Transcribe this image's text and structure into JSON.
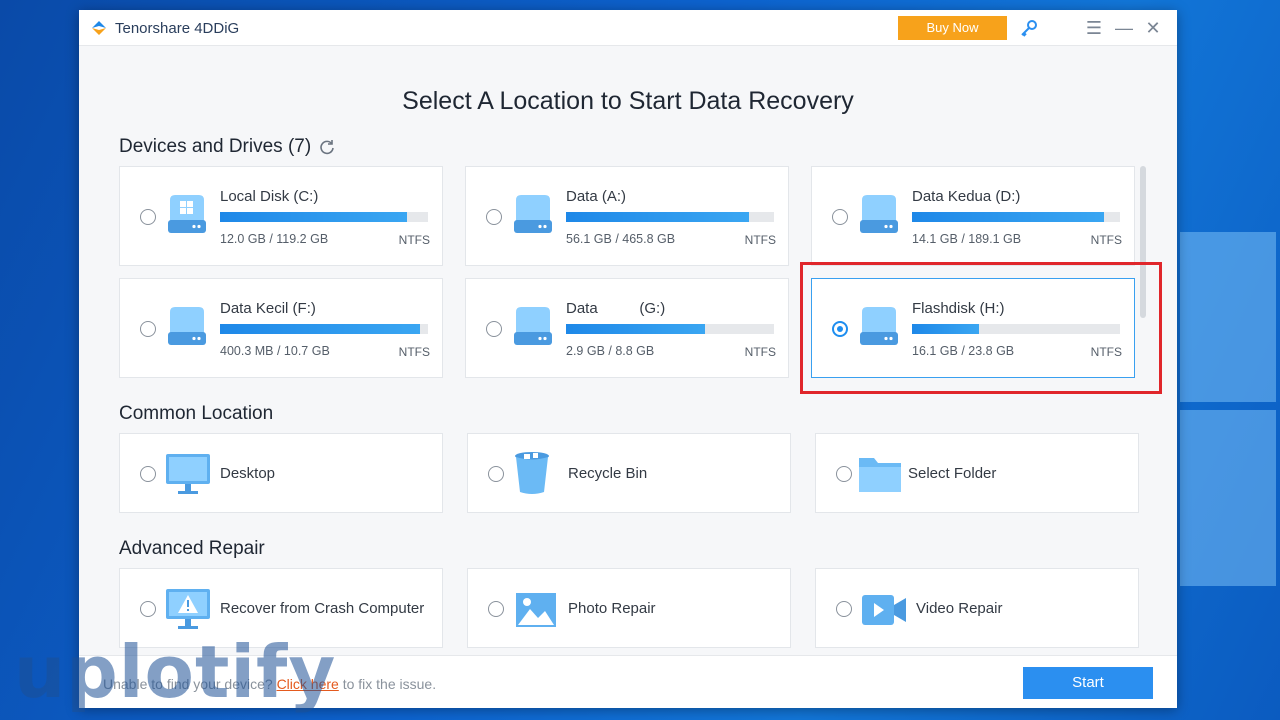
{
  "app": {
    "title": "Tenorshare 4DDiG",
    "buy_label": "Buy Now",
    "brand_color": "#2b8ff0",
    "buy_color": "#f7a21b"
  },
  "heading": "Select A Location to Start Data Recovery",
  "devices": {
    "title": "Devices and Drives (7)",
    "drives": [
      {
        "name": "Local Disk (C:)",
        "size": "12.0 GB / 119.2 GB",
        "fs": "NTFS",
        "used_fraction": 0.9,
        "selected": false
      },
      {
        "name": "Data (A:)",
        "size": "56.1 GB / 465.8 GB",
        "fs": "NTFS",
        "used_fraction": 0.88,
        "selected": false
      },
      {
        "name": "Data Kedua (D:)",
        "size": "14.1 GB / 189.1 GB",
        "fs": "NTFS",
        "used_fraction": 0.925,
        "selected": false
      },
      {
        "name": "Data Kecil (F:)",
        "size": "400.3 MB / 10.7 GB",
        "fs": "NTFS",
        "used_fraction": 0.96,
        "selected": false
      },
      {
        "name": "Data          (G:)",
        "size": "2.9 GB / 8.8 GB",
        "fs": "NTFS",
        "used_fraction": 0.67,
        "selected": false
      },
      {
        "name": "Flashdisk (H:)",
        "size": "16.1 GB / 23.8 GB",
        "fs": "NTFS",
        "used_fraction": 0.32,
        "selected": true
      }
    ]
  },
  "common": {
    "title": "Common Location",
    "items": [
      {
        "label": "Desktop",
        "icon": "monitor-icon"
      },
      {
        "label": "Recycle Bin",
        "icon": "recycle-bin-icon"
      },
      {
        "label": "Select Folder",
        "icon": "folder-icon"
      }
    ]
  },
  "advanced": {
    "title": "Advanced Repair",
    "items": [
      {
        "label": "Recover from Crash Computer",
        "icon": "crash-computer-icon"
      },
      {
        "label": "Photo Repair",
        "icon": "photo-icon"
      },
      {
        "label": "Video Repair",
        "icon": "video-icon"
      }
    ]
  },
  "footer": {
    "prefix": "Unable to find your device? ",
    "link": "Click here",
    "suffix": " to fix the issue.",
    "start_label": "Start"
  },
  "watermark": "uplotify"
}
